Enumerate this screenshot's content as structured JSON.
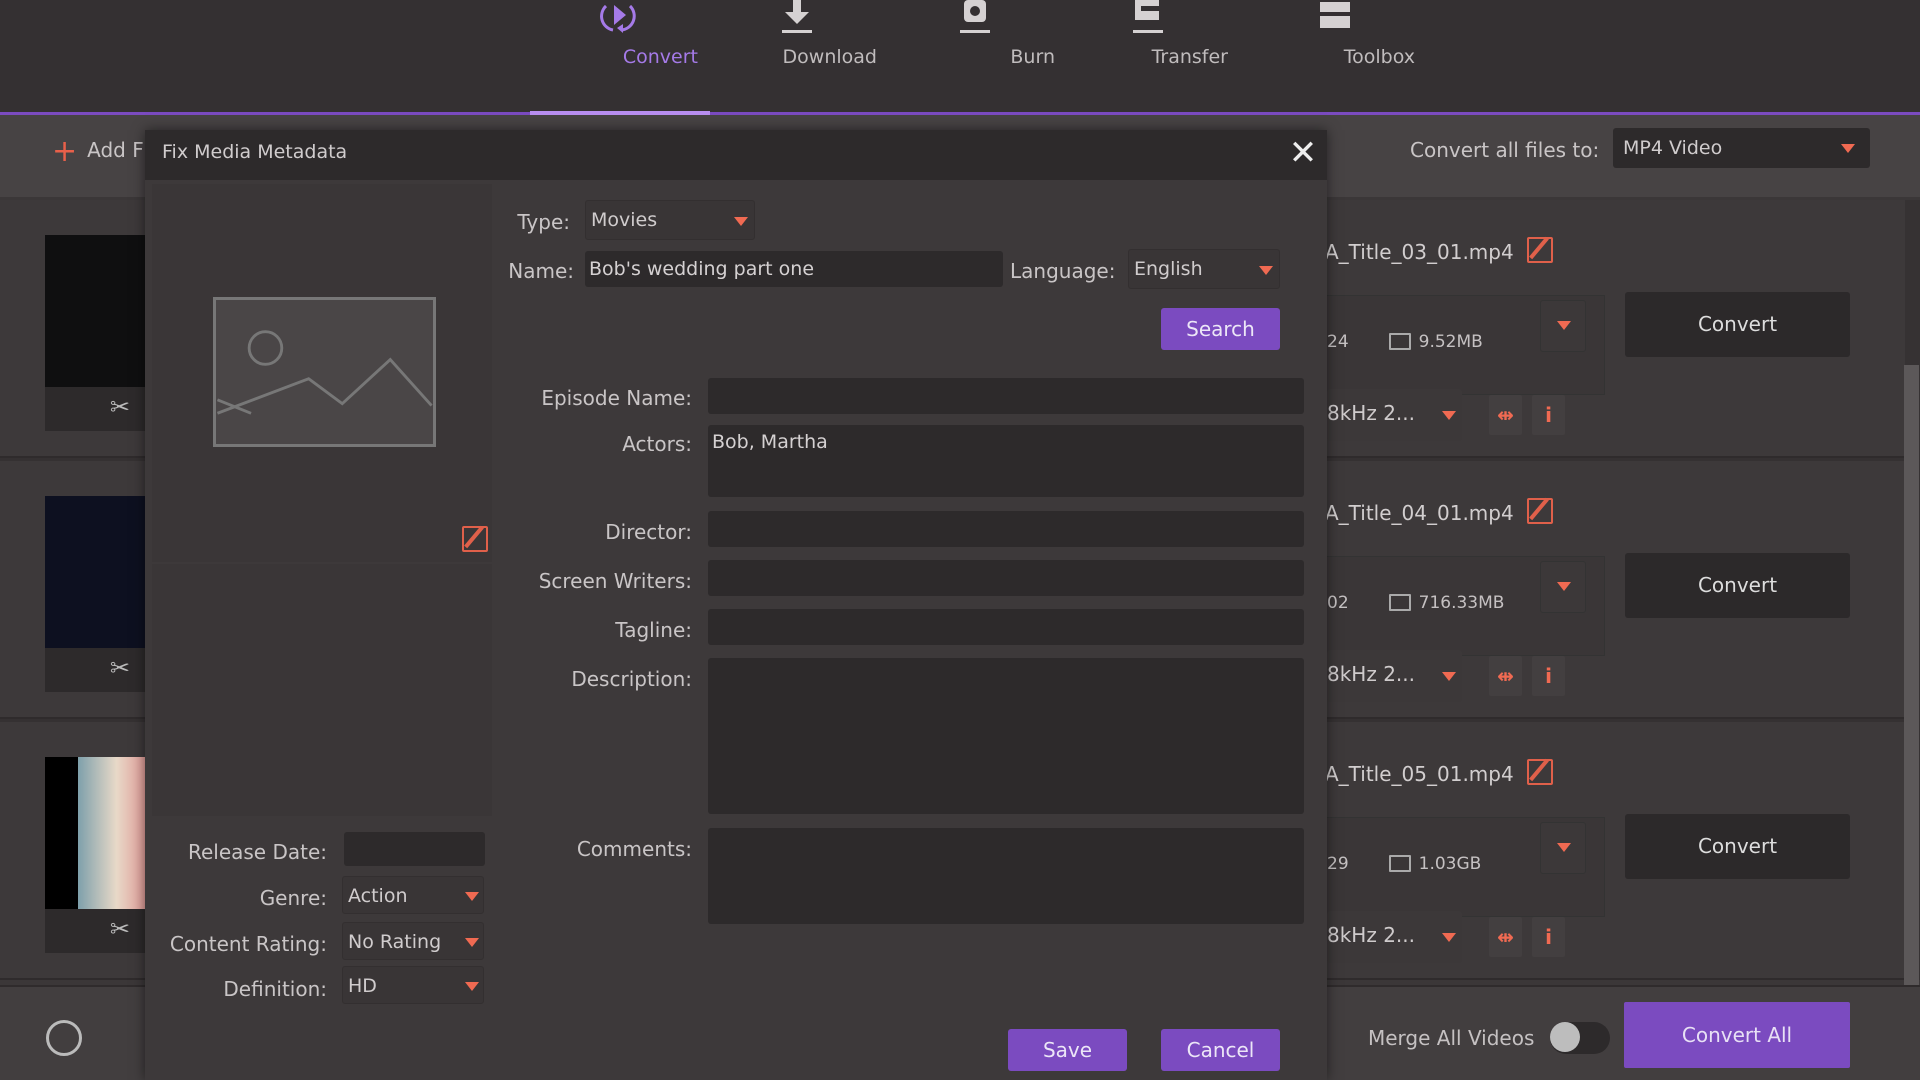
{
  "nav": {
    "items": [
      {
        "label": "Convert",
        "icon": "convert-icon",
        "active": true
      },
      {
        "label": "Download",
        "icon": "download-icon",
        "active": false
      },
      {
        "label": "Burn",
        "icon": "burn-icon",
        "active": false
      },
      {
        "label": "Transfer",
        "icon": "transfer-icon",
        "active": false
      },
      {
        "label": "Toolbox",
        "icon": "toolbox-icon",
        "active": false
      }
    ],
    "accent": "#7b4bc0"
  },
  "toolbar": {
    "add_files_label": "Add F",
    "convert_all_label": "Convert all files to:",
    "convert_all_value": "MP4 Video"
  },
  "files": [
    {
      "name": "A_Title_03_01.mp4",
      "duration_tail": "24",
      "size": "9.52MB",
      "audio": "8kHz 2...",
      "convert_label": "Convert"
    },
    {
      "name": "A_Title_04_01.mp4",
      "duration_tail": "02",
      "size": "716.33MB",
      "audio": "8kHz 2...",
      "convert_label": "Convert"
    },
    {
      "name": "A_Title_05_01.mp4",
      "duration_tail": "29",
      "size": "1.03GB",
      "audio": "8kHz 2...",
      "convert_label": "Convert"
    }
  ],
  "bottom": {
    "merge_label": "Merge All Videos",
    "merge_on": false,
    "convert_all_button": "Convert All"
  },
  "dialog": {
    "title": "Fix Media Metadata",
    "type_label": "Type:",
    "type_value": "Movies",
    "name_label": "Name:",
    "name_value": "Bob's wedding part one",
    "language_label": "Language:",
    "language_value": "English",
    "search_button": "Search",
    "episode_label": "Episode Name:",
    "episode_value": "",
    "actors_label": "Actors:",
    "actors_value": "Bob, Martha",
    "director_label": "Director:",
    "director_value": "",
    "writers_label": "Screen Writers:",
    "writers_value": "",
    "tagline_label": "Tagline:",
    "tagline_value": "",
    "description_label": "Description:",
    "description_value": "",
    "comments_label": "Comments:",
    "comments_value": "",
    "release_label": "Release Date:",
    "release_value": "",
    "genre_label": "Genre:",
    "genre_value": "Action",
    "rating_label": "Content Rating:",
    "rating_value": "No Rating",
    "definition_label": "Definition:",
    "definition_value": "HD",
    "save_button": "Save",
    "cancel_button": "Cancel"
  }
}
